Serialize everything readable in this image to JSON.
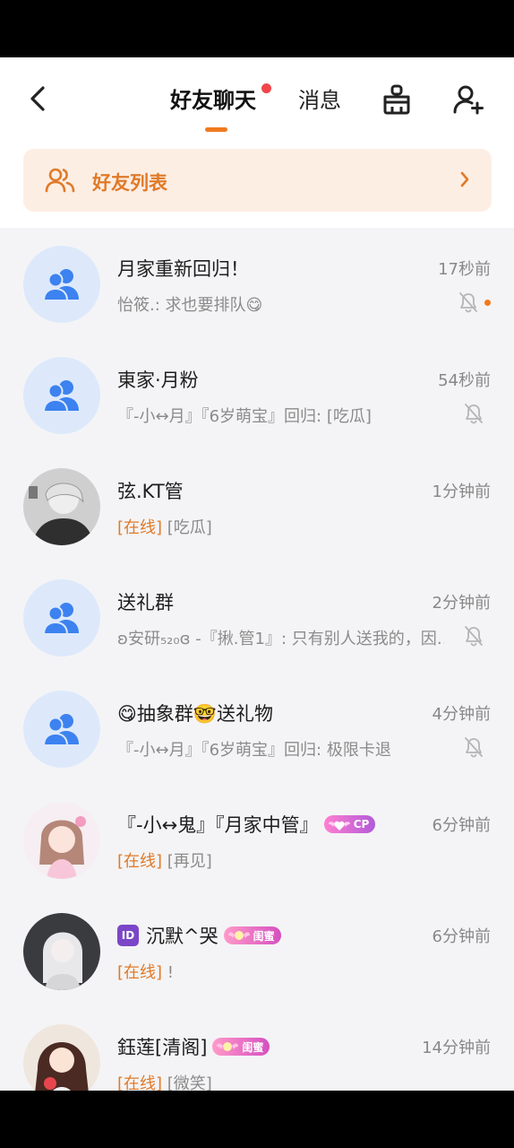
{
  "header": {
    "tabs": [
      {
        "label": "好友聊天",
        "active": true,
        "has_dot": true
      },
      {
        "label": "消息",
        "active": false,
        "has_dot": false
      }
    ],
    "icons": {
      "back": "chevron-left-icon",
      "clean": "broom-icon",
      "add_friend": "add-user-icon"
    }
  },
  "friends_banner": {
    "label": "好友列表",
    "icon": "two-users-icon",
    "chevron": "chevron-right-icon"
  },
  "colors": {
    "accent": "#f07a1f",
    "online": "#e07a28",
    "group_avatar_bg": "#dde9fb",
    "group_icon": "#3c82f0",
    "banner_bg": "#fdeee4"
  },
  "chats": [
    {
      "name": "月家重新回归！",
      "time": "17秒前",
      "preview": "怡筱.: 求也要排队😋",
      "muted": true,
      "unread_dot": true,
      "avatar": "group"
    },
    {
      "name": "東家·月粉",
      "time": "54秒前",
      "preview": "『-小↔月』『6岁萌宝』回归: [吃瓜]",
      "muted": true,
      "unread_dot": false,
      "avatar": "group"
    },
    {
      "name": "弦.KT管",
      "time": "1分钟前",
      "online_tag": "[在线]",
      "preview": " [吃瓜]",
      "muted": false,
      "avatar": "photo"
    },
    {
      "name": "送礼群",
      "time": "2分钟前",
      "preview": "ʚ安研₅₂₀ɞ -『揪.管1』: 只有别人送我的，因…",
      "muted": true,
      "avatar": "group"
    },
    {
      "name": "😋抽象群🤓送礼物",
      "time": "4分钟前",
      "preview": "『-小↔月』『6岁萌宝』回归: 极限卡退",
      "muted": true,
      "avatar": "group"
    },
    {
      "name": "『-小↔鬼』『月家中管』",
      "badge": "CP",
      "time": "6分钟前",
      "online_tag": "[在线]",
      "preview": " [再见]",
      "muted": false,
      "avatar": "photo"
    },
    {
      "id_tag": "ID",
      "name": "沉默^哭",
      "badge": "闺蜜",
      "time": "6分钟前",
      "online_tag": "[在线]",
      "preview": " !",
      "muted": false,
      "avatar": "photo"
    },
    {
      "name": "鈺莲[清阁]",
      "badge": "闺蜜",
      "time": "14分钟前",
      "online_tag": "[在线]",
      "preview": " [微笑]",
      "muted": false,
      "avatar": "photo"
    }
  ]
}
